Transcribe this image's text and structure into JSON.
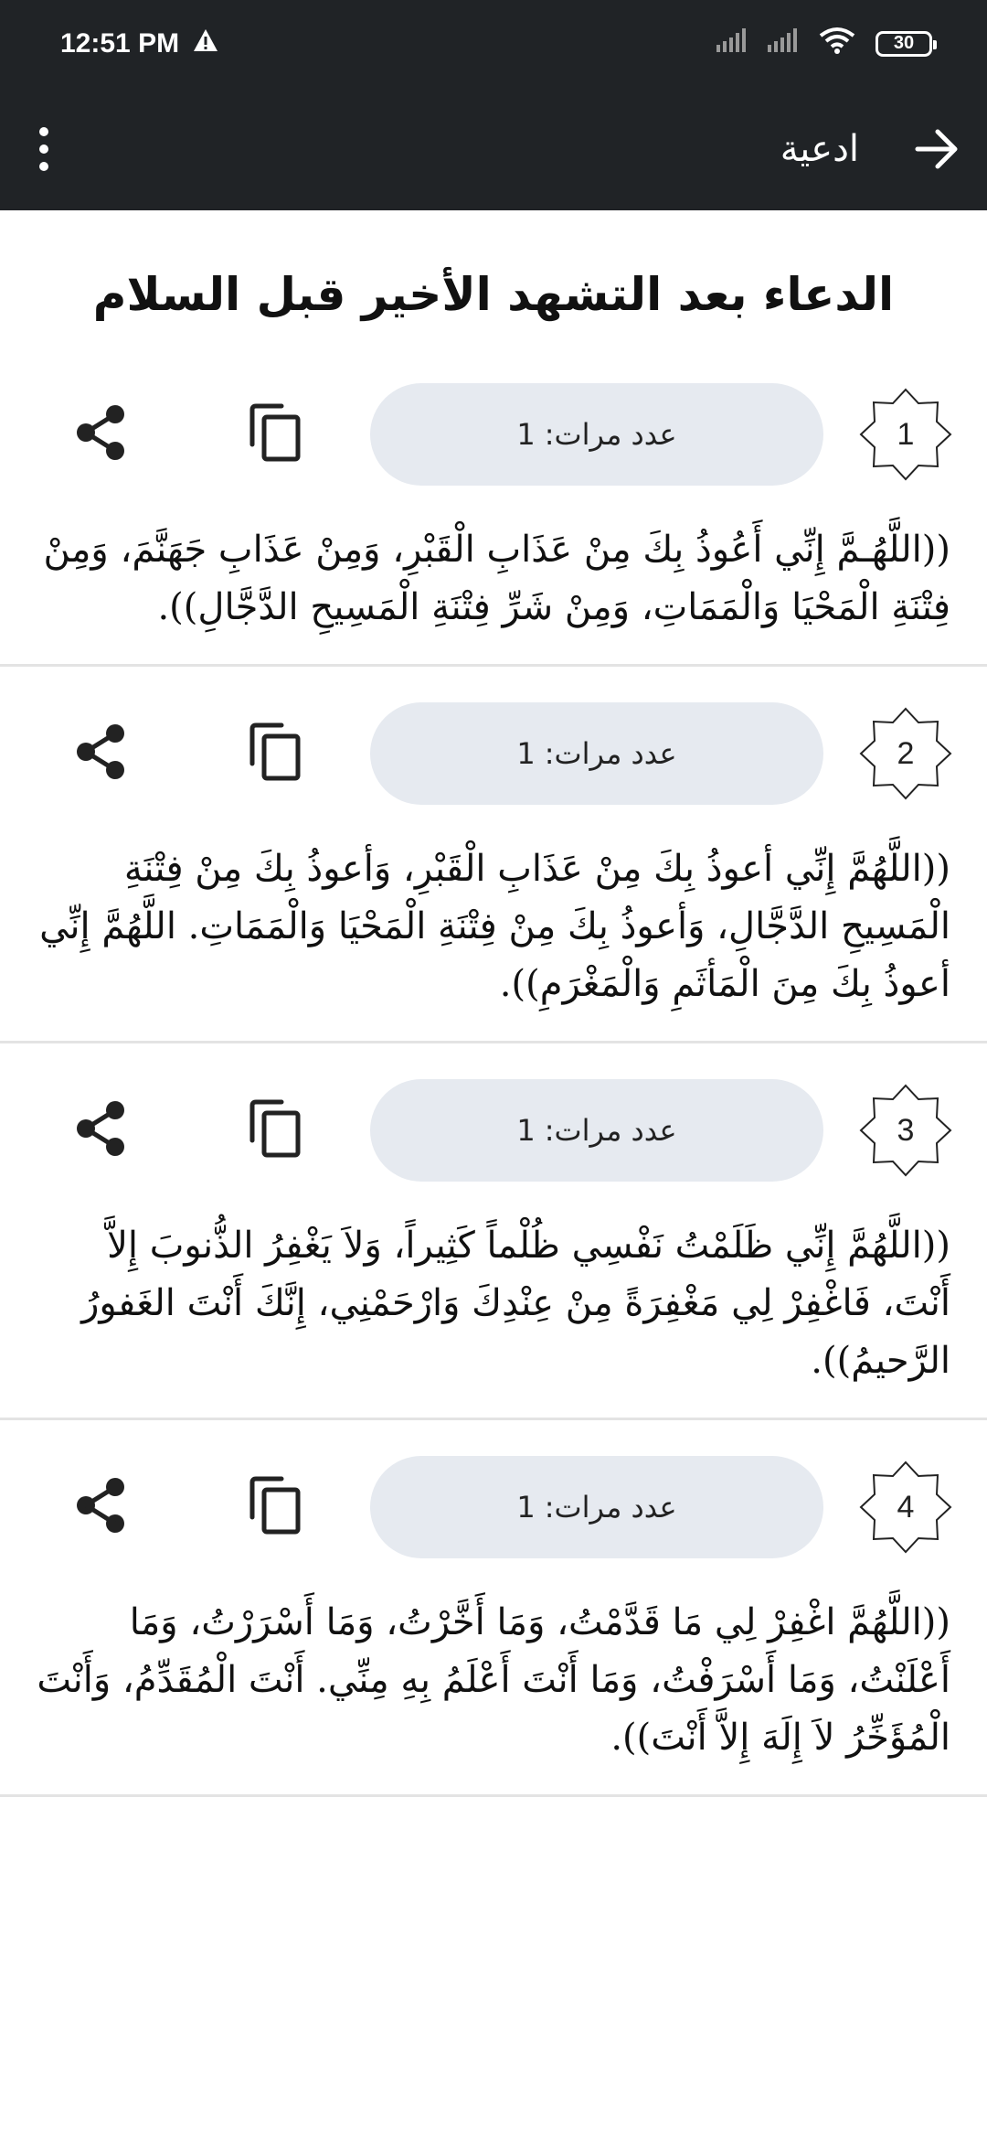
{
  "status": {
    "time": "12:51 PM",
    "battery": "30"
  },
  "appbar": {
    "title": "ادعية"
  },
  "page": {
    "title": "الدعاء بعد التشهد الأخير قبل السلام"
  },
  "items": [
    {
      "number": "1",
      "count_label": "عدد مرات:",
      "count": "1",
      "text": "((اللَّهُـمَّ إِنِّي أَعُوذُ بِكَ مِنْ عَذَابِ الْقَبْرِ، وَمِنْ عَذَابِ جَهَنَّمَ، وَمِنْ فِتْنَةِ الْمَحْيَا وَالْمَمَاتِ، وَمِنْ شَرِّ فِتْنَةِ الْمَسِيحِ الدَّجَّالِ))."
    },
    {
      "number": "2",
      "count_label": "عدد مرات:",
      "count": "1",
      "text": "((اللَّهُمَّ إِنِّي أعوذُ بِكَ مِنْ عَذَابِ الْقَبْرِ، وَأعوذُ بِكَ مِنْ فِتْنَةِ الْمَسِيحِ الدَّجَّالِ، وَأعوذُ بِكَ مِنْ فِتْنَةِ الْمَحْيَا وَالْمَمَاتِ. اللَّهُمَّ إِنِّي أعوذُ بِكَ مِنَ الْمَأثَمِ وَالْمَغْرَمِ))."
    },
    {
      "number": "3",
      "count_label": "عدد مرات:",
      "count": "1",
      "text": "((اللَّهُمَّ إِنِّي ظَلَمْتُ نَفْسِي ظُلْماً كَثِيراً، وَلاَ يَغْفِرُ الذُّنوبَ إِلاَّ أَنْتَ، فَاغْفِرْ لِي مَغْفِرَةً مِنْ عِنْدِكَ وَارْحَمْنِي، إِنَّكَ أَنْتَ الغَفورُ الرَّحيمُ))."
    },
    {
      "number": "4",
      "count_label": "عدد مرات:",
      "count": "1",
      "text": "((اللَّهُمَّ اغْفِرْ لِي مَا قَدَّمْتُ، وَمَا أَخَّرْتُ، وَمَا أَسْرَرْتُ، وَمَا أَعْلَنْتُ، وَمَا أَسْرَفْتُ، وَمَا أَنْتَ أَعْلَمُ بِهِ مِنِّي. أَنْتَ الْمُقَدِّمُ، وَأَنْتَ الْمُؤَخِّرُ لاَ إِلَهَ إِلاَّ أَنْتَ))."
    }
  ]
}
